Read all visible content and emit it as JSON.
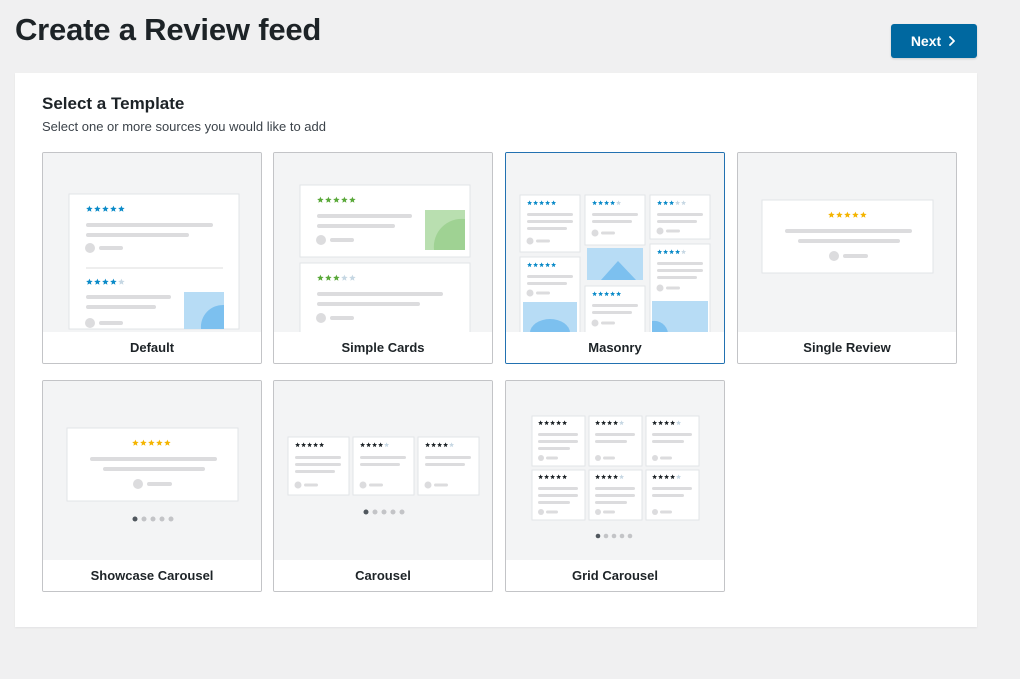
{
  "page": {
    "title": "Create a Review feed",
    "next_label": "Next"
  },
  "panel": {
    "title": "Select a Template",
    "subtitle": "Select one or more sources you would like to add"
  },
  "templates": [
    {
      "label": "Default",
      "selected": false
    },
    {
      "label": "Simple Cards",
      "selected": false
    },
    {
      "label": "Masonry",
      "selected": true
    },
    {
      "label": "Single Review",
      "selected": false
    },
    {
      "label": "Showcase Carousel",
      "selected": false
    },
    {
      "label": "Carousel",
      "selected": false
    },
    {
      "label": "Grid Carousel",
      "selected": false
    }
  ],
  "colors": {
    "accent": "#0068a0",
    "selected_border": "#2271b1",
    "star_blue": "#0a8ac8",
    "star_green": "#59a839",
    "star_gold": "#f4b400",
    "star_dark": "#1d2327",
    "placeholder": "#dcdcde",
    "image_blue": "#b7dcf5",
    "image_green": "#b9dfb0"
  }
}
